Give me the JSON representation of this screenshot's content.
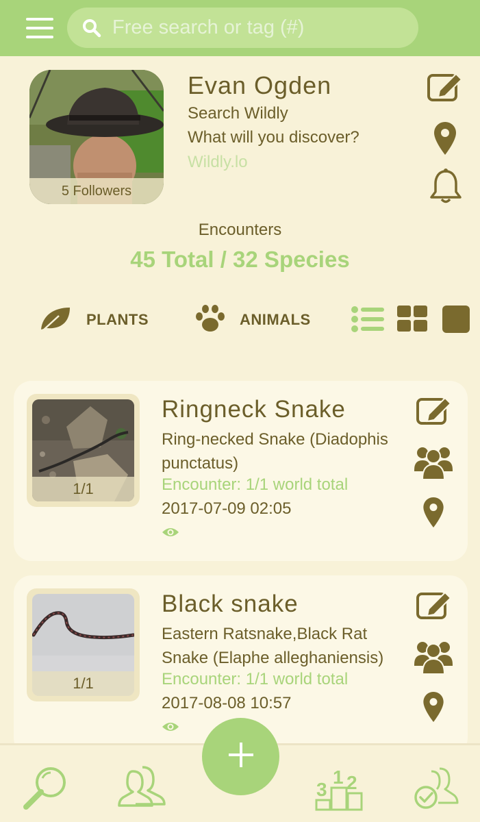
{
  "search": {
    "placeholder": "Free search or tag (#)"
  },
  "profile": {
    "name": "Evan Ogden",
    "line1": "Search Wildly",
    "line2": "What will you discover?",
    "link": "Wildly.lo",
    "followers": "5 Followers"
  },
  "encounters": {
    "label": "Encounters",
    "total": "45 Total / 32 Species"
  },
  "filters": {
    "plants": "PLANTS",
    "animals": "ANIMALS"
  },
  "cards": [
    {
      "title": "Ringneck Snake",
      "scientific": "Ring-necked Snake (Diadophis punctatus)",
      "encounter": "Encounter: 1/1 world total",
      "date": "2017-07-09 02:05",
      "count": "1/1"
    },
    {
      "title": "Black snake",
      "scientific": "Eastern Ratsnake,Black Rat Snake (Elaphe alleghaniensis)",
      "encounter": "Encounter: 1/1 world total",
      "date": "2017-08-08 10:57",
      "count": "1/1"
    }
  ],
  "colors": {
    "accent": "#a8d47a",
    "text": "#6b5e2a",
    "background": "#f8f2d8",
    "icon": "#7a6a2e"
  }
}
